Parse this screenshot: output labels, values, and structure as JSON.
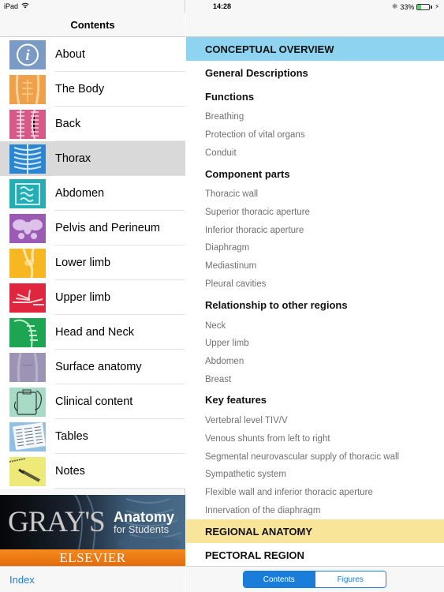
{
  "status_bar": {
    "device": "iPad",
    "time": "14:28",
    "battery_percent": "33%",
    "battery_level": 0.33,
    "icons": [
      "wifi-icon",
      "bluetooth-icon",
      "battery-icon",
      "charging-icon"
    ]
  },
  "left_pane": {
    "title": "Contents",
    "items": [
      {
        "label": "About",
        "icon": "info-icon",
        "color": "#7b9bc4",
        "selected": false
      },
      {
        "label": "The Body",
        "icon": "torso-icon",
        "color": "#eea04a",
        "selected": false
      },
      {
        "label": "Back",
        "icon": "spine-icon",
        "color": "#d65a86",
        "selected": false
      },
      {
        "label": "Thorax",
        "icon": "ribcage-icon",
        "color": "#2b86cf",
        "selected": true
      },
      {
        "label": "Abdomen",
        "icon": "intestines-icon",
        "color": "#25adb3",
        "selected": false
      },
      {
        "label": "Pelvis and Perineum",
        "icon": "pelvis-icon",
        "color": "#9b5ab4",
        "selected": false
      },
      {
        "label": "Lower limb",
        "icon": "knee-icon",
        "color": "#f6b722",
        "selected": false
      },
      {
        "label": "Upper limb",
        "icon": "hand-icon",
        "color": "#e0263e",
        "selected": false
      },
      {
        "label": "Head and Neck",
        "icon": "neck-icon",
        "color": "#1ea553",
        "selected": false
      },
      {
        "label": "Surface anatomy",
        "icon": "body-surface-icon",
        "color": "#9d93b5",
        "selected": false
      },
      {
        "label": "Clinical content",
        "icon": "clipboard-stethoscope-icon",
        "color": "#a7dbc6",
        "selected": false
      },
      {
        "label": "Tables",
        "icon": "table-icon",
        "color": "#92c0e3",
        "selected": false
      },
      {
        "label": "Notes",
        "icon": "notepad-pencil-icon",
        "color": "#eeea7a",
        "selected": false
      }
    ],
    "banner": {
      "brand": "GRAY'S",
      "title_line1": "Anatomy",
      "title_line2": "for Students",
      "publisher": "ELSEVIER"
    },
    "index_link": "Index"
  },
  "right_pane": {
    "sections": [
      {
        "label": "CONCEPTUAL OVERVIEW",
        "color": "#8ed4f0",
        "groups": [
          {
            "heading": "General Descriptions",
            "items": []
          },
          {
            "heading": "Functions",
            "items": [
              "Breathing",
              "Protection of vital organs",
              "Conduit"
            ]
          },
          {
            "heading": "Component parts",
            "items": [
              "Thoracic wall",
              "Superior thoracic aperture",
              "Inferior thoracic aperture",
              "Diaphragm",
              "Mediastinum",
              "Pleural cavities"
            ]
          },
          {
            "heading": "Relationship to other regions",
            "items": [
              "Neck",
              "Upper limb",
              "Abdomen",
              "Breast"
            ]
          },
          {
            "heading": "Key features",
            "items": [
              "Vertebral level TIV/V",
              "Venous shunts from left to right",
              "Segmental neurovascular supply of thoracic wall",
              "Sympathetic system",
              "Flexible wall and inferior thoracic aperture",
              "Innervation of the diaphragm"
            ]
          }
        ]
      },
      {
        "label": "REGIONAL ANATOMY",
        "color": "#f8e59a",
        "groups": [
          {
            "heading": "PECTORAL REGION",
            "items": []
          }
        ]
      }
    ],
    "segmented_control": {
      "options": [
        "Contents",
        "Figures"
      ],
      "selected": "Contents"
    }
  }
}
